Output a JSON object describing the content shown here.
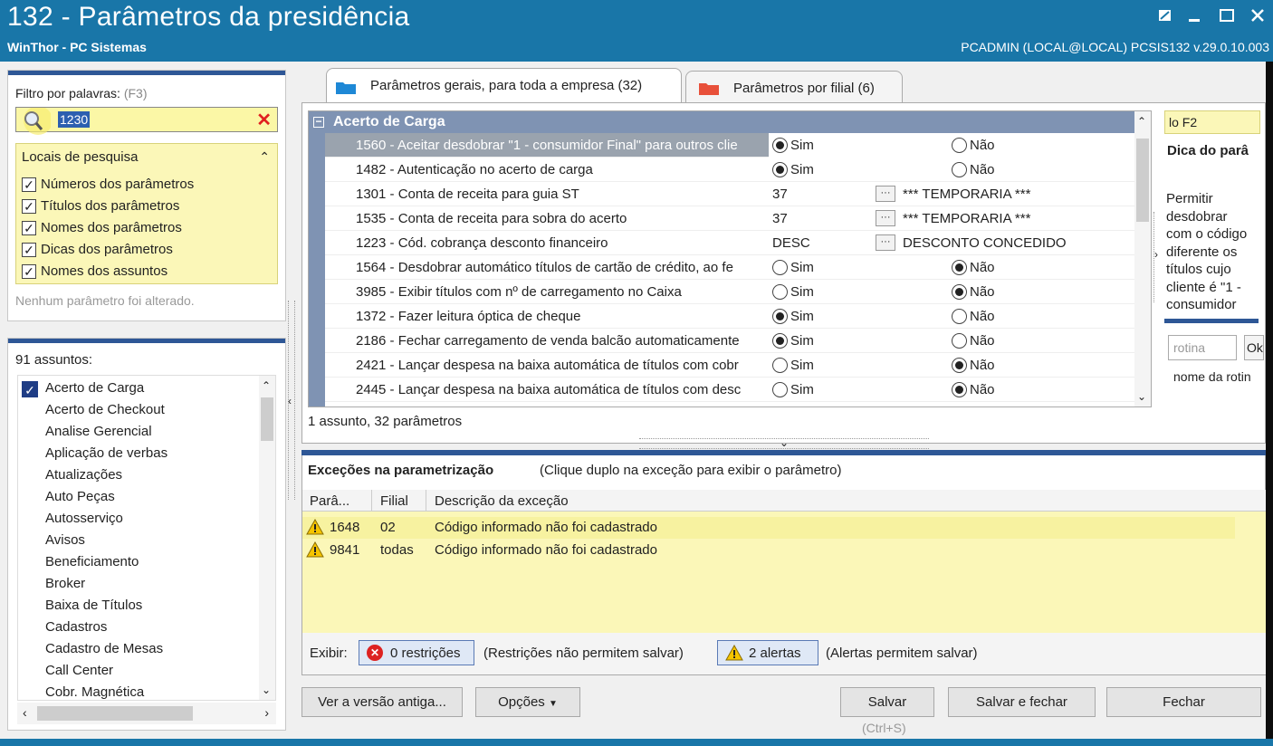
{
  "window": {
    "title": "132 - Parâmetros da presidência",
    "subtitle": "WinThor - PC Sistemas",
    "user_info": "PCADMIN (LOCAL@LOCAL)   PCSIS132  v.29.0.10.003"
  },
  "filter": {
    "label": "Filtro por palavras:",
    "shortcut": "(F3)",
    "value": "1230",
    "search_locations_title": "Locais de pesquisa",
    "options": [
      {
        "label": "Números dos parâmetros",
        "checked": true
      },
      {
        "label": "Títulos dos parâmetros",
        "checked": true
      },
      {
        "label": "Nomes dos parâmetros",
        "checked": true
      },
      {
        "label": "Dicas dos parâmetros",
        "checked": true
      },
      {
        "label": "Nomes dos assuntos",
        "checked": true
      }
    ],
    "status": "Nenhum parâmetro foi alterado."
  },
  "subjects": {
    "count_label": "91 assuntos:",
    "items": [
      "Acerto de Carga",
      "Acerto de Checkout",
      "Analise Gerencial",
      "Aplicação de verbas",
      "Atualizações",
      "Auto Peças",
      "Autosserviço",
      "Avisos",
      "Beneficiamento",
      "Broker",
      "Baixa de Títulos",
      "Cadastros",
      "Cadastro de Mesas",
      "Call Center",
      "Cobr. Magnética"
    ],
    "selected": "Acerto de Carga"
  },
  "tabs": [
    {
      "label": "Parâmetros gerais, para toda a empresa  (32)",
      "active": true,
      "color": "#1e88d6"
    },
    {
      "label": "Parâmetros por filial  (6)",
      "active": false,
      "color": "#e8503a"
    }
  ],
  "grid": {
    "group": "Acerto de Carga",
    "rows": [
      {
        "name": "1560 - Aceitar desdobrar \"1 - consumidor Final\" para outros clie",
        "type": "radio",
        "value": "Sim",
        "selected": true
      },
      {
        "name": "1482 - Autenticação no acerto de carga",
        "type": "radio",
        "value": "Sim"
      },
      {
        "name": "1301 - Conta de receita para guia ST",
        "type": "lookup",
        "code": "37",
        "desc": "*** TEMPORARIA ***"
      },
      {
        "name": "1535 - Conta de receita para sobra do acerto",
        "type": "lookup",
        "code": "37",
        "desc": "*** TEMPORARIA ***"
      },
      {
        "name": "1223 - Cód. cobrança desconto financeiro",
        "type": "lookup",
        "code": "DESC",
        "desc": "DESCONTO CONCEDIDO"
      },
      {
        "name": "1564 - Desdobrar automático títulos de cartão de crédito, ao fe",
        "type": "radio",
        "value": "Não"
      },
      {
        "name": "3985 - Exibir títulos com nº de carregamento no Caixa",
        "type": "radio",
        "value": "Não"
      },
      {
        "name": "1372 - Fazer leitura óptica de cheque",
        "type": "radio",
        "value": "Sim"
      },
      {
        "name": "2186 - Fechar carregamento de venda balcão automaticamente",
        "type": "radio",
        "value": "Sim"
      },
      {
        "name": "2421 - Lançar despesa na baixa automática de títulos com cobr",
        "type": "radio",
        "value": "Não"
      },
      {
        "name": "2445 - Lançar despesa na baixa automática de títulos com desc",
        "type": "radio",
        "value": "Não"
      }
    ],
    "yes_label": "Sim",
    "no_label": "Não",
    "lookup_button": "···",
    "status": "1 assunto, 32 parâmetros"
  },
  "hint": {
    "search_value": "lo F2",
    "title": "Dica do parâ",
    "body": [
      "Permitir",
      "desdobrar",
      "com o código",
      "diferente os",
      "títulos cujo",
      "cliente é \"1 -",
      "consumidor"
    ],
    "rotina_placeholder": "rotina",
    "rotina_button": "Ok",
    "rotina_name": "nome da rotin"
  },
  "exceptions": {
    "title": "Exceções na parametrização",
    "subtitle": "(Clique duplo na exceção para exibir o parâmetro)",
    "columns": [
      "Parâ...",
      "Filial",
      "Descrição da exceção"
    ],
    "rows": [
      {
        "param": "1648",
        "filial": "02",
        "desc": "Código informado não foi cadastrado"
      },
      {
        "param": "9841",
        "filial": "todas",
        "desc": "Código informado não foi cadastrado"
      }
    ],
    "show_label": "Exibir:",
    "restrictions_button": "0 restrições",
    "restrictions_note": "(Restrições não permitem salvar)",
    "alerts_button": "2 alertas",
    "alerts_note": "(Alertas permitem salvar)"
  },
  "buttons": {
    "old_version": "Ver a versão antiga...",
    "options": "Opções",
    "save": "Salvar",
    "save_shortcut": "(Ctrl+S)",
    "save_close": "Salvar e fechar",
    "close": "Fechar"
  }
}
